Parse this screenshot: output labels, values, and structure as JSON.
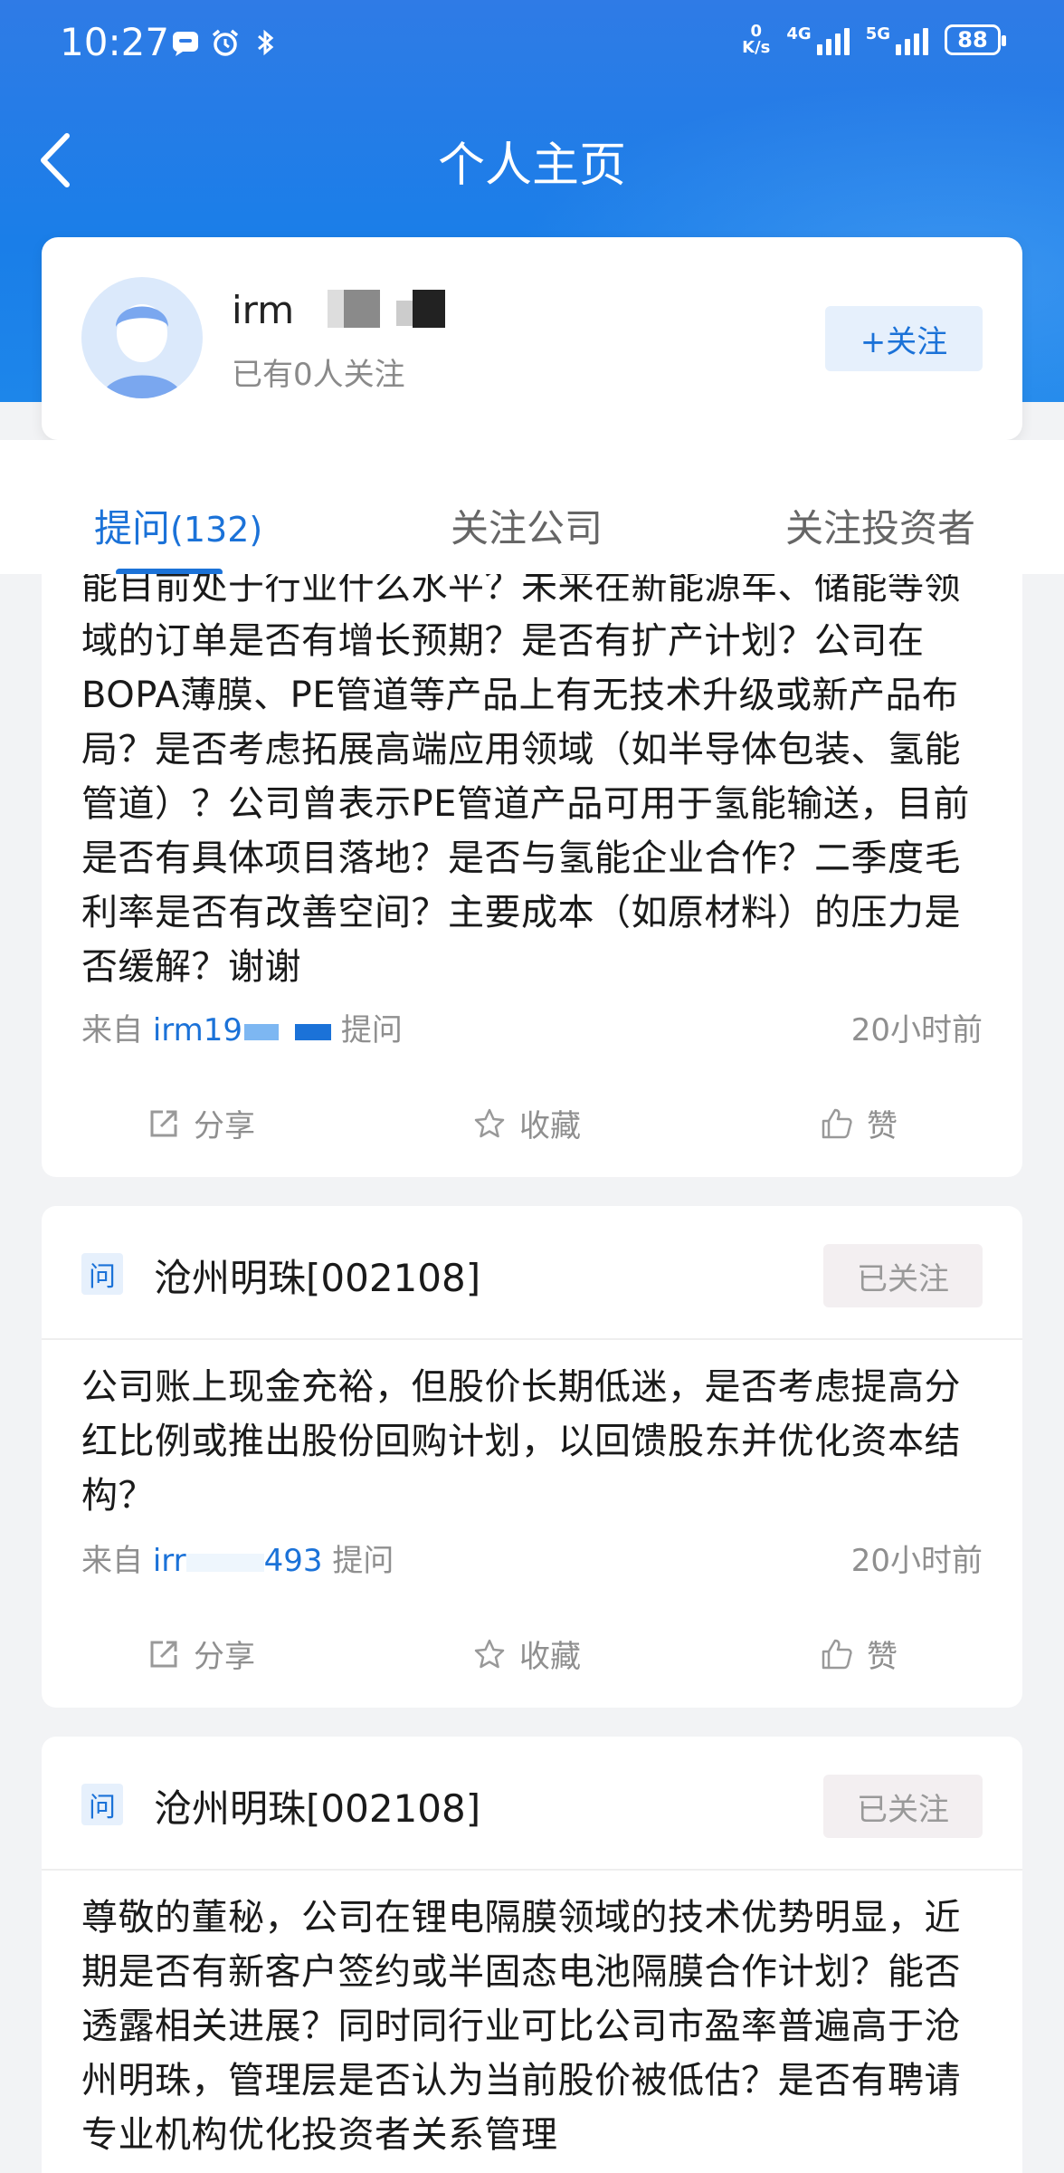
{
  "status_bar": {
    "time": "10:27",
    "net_speed_value": "0",
    "net_speed_unit": "K/s",
    "signal_1": "4G",
    "signal_2": "5G",
    "battery": "88"
  },
  "nav": {
    "title": "个人主页"
  },
  "profile": {
    "name": "irm",
    "followers": "已有0人关注",
    "follow_label": "+关注"
  },
  "tabs": [
    {
      "label": "提问",
      "count": "(132)"
    },
    {
      "label": "关注公司"
    },
    {
      "label": "关注投资者"
    }
  ],
  "cards": [
    {
      "text": "能目前处于行业什么水平？未来在新能源车、储能等领域的订单是否有增长预期？是否有扩产计划？公司在BOPA薄膜、PE管道等产品上有无技术升级或新产品布局？是否考虑拓展高端应用领域（如半导体包装、氢能管道）？公司曾表示PE管道产品可用于氢能输送，目前是否有具体项目落地？是否与氢能企业合作？二季度毛利率是否有改善空间？主要成本（如原材料）的压力是否缓解？谢谢",
      "from_label": "来自",
      "user": "irm19",
      "suffix": "提问",
      "time": "20小时前",
      "share": "分享",
      "fav": "收藏",
      "like": "赞"
    },
    {
      "company": "沧州明珠[002108]",
      "badge": "问",
      "followed": "已关注",
      "text": "公司账上现金充裕，但股价长期低迷，是否考虑提高分红比例或推出股份回购计划，以回馈股东并优化资本结构？",
      "from_label": "来自",
      "user_start": "irr",
      "user_end": "493",
      "suffix": "提问",
      "time": "20小时前",
      "share": "分享",
      "fav": "收藏",
      "like": "赞"
    },
    {
      "company": "沧州明珠[002108]",
      "badge": "问",
      "followed": "已关注",
      "text": "尊敬的董秘，公司在锂电隔膜领域的技术优势明显，近期是否有新客户签约或半固态电池隔膜合作计划？能否透露相关进展？同时同行业可比公司市盈率普遍高于沧州明珠，管理层是否认为当前股价被低估？是否有聘请专业机构优化投资者关系管理"
    }
  ]
}
